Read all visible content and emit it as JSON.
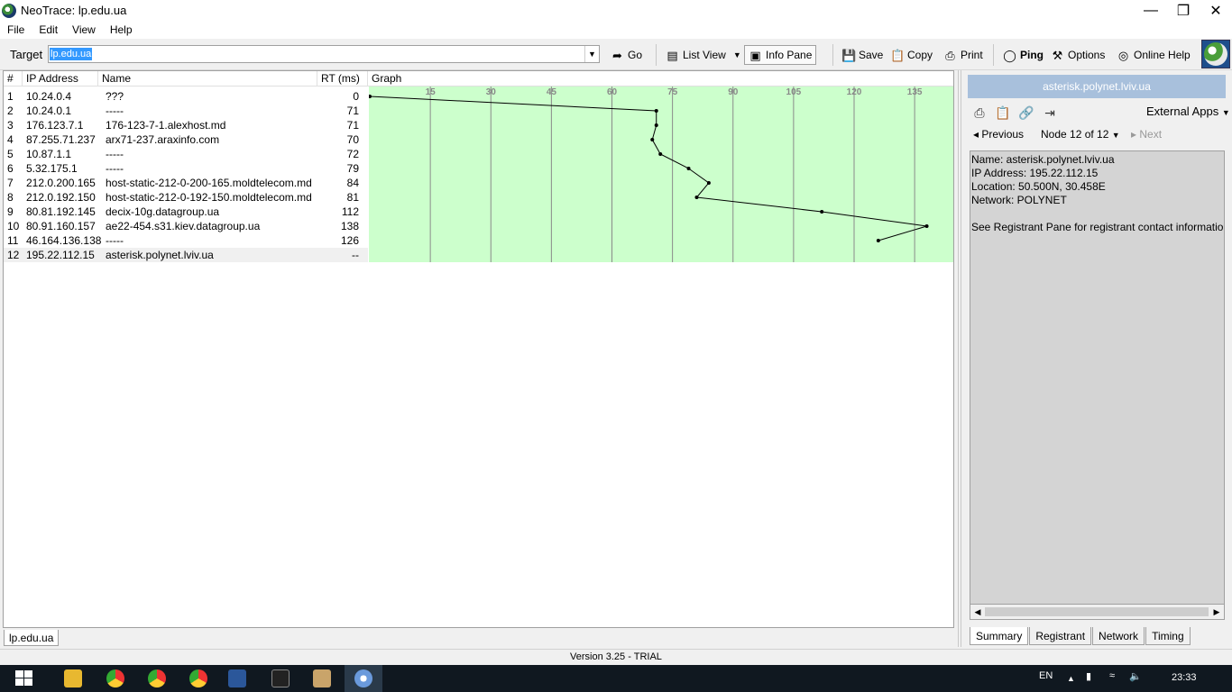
{
  "window": {
    "title": "NeoTrace: lp.edu.ua"
  },
  "menu": [
    "File",
    "Edit",
    "View",
    "Help"
  ],
  "toolbar": {
    "target_label": "Target",
    "target_value": "lp.edu.ua",
    "go": "Go",
    "list_view": "List View",
    "info_pane": "Info Pane",
    "save": "Save",
    "copy": "Copy",
    "print": "Print",
    "ping": "Ping",
    "options": "Options",
    "online_help": "Online Help"
  },
  "table": {
    "columns": [
      "#",
      "IP Address",
      "Name",
      "RT (ms)",
      "Graph"
    ],
    "rows": [
      {
        "n": "1",
        "ip": "10.24.0.4",
        "name": "???",
        "rt": "0"
      },
      {
        "n": "2",
        "ip": "10.24.0.1",
        "name": "-----",
        "rt": "71"
      },
      {
        "n": "3",
        "ip": "176.123.7.1",
        "name": "176-123-7-1.alexhost.md",
        "rt": "71"
      },
      {
        "n": "4",
        "ip": "87.255.71.237",
        "name": "arx71-237.araxinfo.com",
        "rt": "70"
      },
      {
        "n": "5",
        "ip": "10.87.1.1",
        "name": "-----",
        "rt": "72"
      },
      {
        "n": "6",
        "ip": "5.32.175.1",
        "name": "-----",
        "rt": "79"
      },
      {
        "n": "7",
        "ip": "212.0.200.165",
        "name": "host-static-212-0-200-165.moldtelecom.md",
        "rt": "84"
      },
      {
        "n": "8",
        "ip": "212.0.192.150",
        "name": "host-static-212-0-192-150.moldtelecom.md",
        "rt": "81"
      },
      {
        "n": "9",
        "ip": "80.81.192.145",
        "name": "decix-10g.datagroup.ua",
        "rt": "112"
      },
      {
        "n": "10",
        "ip": "80.91.160.157",
        "name": "ae22-454.s31.kiev.datagroup.ua",
        "rt": "138"
      },
      {
        "n": "11",
        "ip": "46.164.136.138",
        "name": "-----",
        "rt": "126"
      },
      {
        "n": "12",
        "ip": "195.22.112.15",
        "name": "asterisk.polynet.lviv.ua",
        "rt": "--"
      }
    ],
    "tab": "lp.edu.ua"
  },
  "chart_data": {
    "type": "line",
    "x_ticks": [
      15,
      30,
      45,
      60,
      75,
      90,
      105,
      120,
      135
    ],
    "xlim": [
      0,
      145
    ],
    "x": [
      0,
      71,
      71,
      70,
      72,
      79,
      84,
      81,
      112,
      138,
      126
    ],
    "y": [
      1,
      2,
      3,
      4,
      5,
      6,
      7,
      8,
      9,
      10,
      11
    ],
    "grid": true,
    "background": "#ccffcc",
    "title": "",
    "xlabel": "",
    "ylabel": ""
  },
  "info": {
    "header": "asterisk.polynet.lviv.ua",
    "external_apps": "External Apps",
    "previous": "Previous",
    "node_select": "Node 12 of 12",
    "next": "Next",
    "lines": [
      "Name: asterisk.polynet.lviv.ua",
      "IP Address: 195.22.112.15",
      "Location: 50.500N,  30.458E",
      "Network: POLYNET",
      "",
      "See Registrant Pane for registrant contact information"
    ],
    "tabs": [
      "Summary",
      "Registrant",
      "Network",
      "Timing"
    ]
  },
  "status": {
    "version": "Version 3.25 - TRIAL"
  },
  "taskbar": {
    "lang": "EN",
    "time": "23:33"
  },
  "colors": {
    "graph_bg": "#ccffcc",
    "header_bar": "#a8c0dc"
  }
}
